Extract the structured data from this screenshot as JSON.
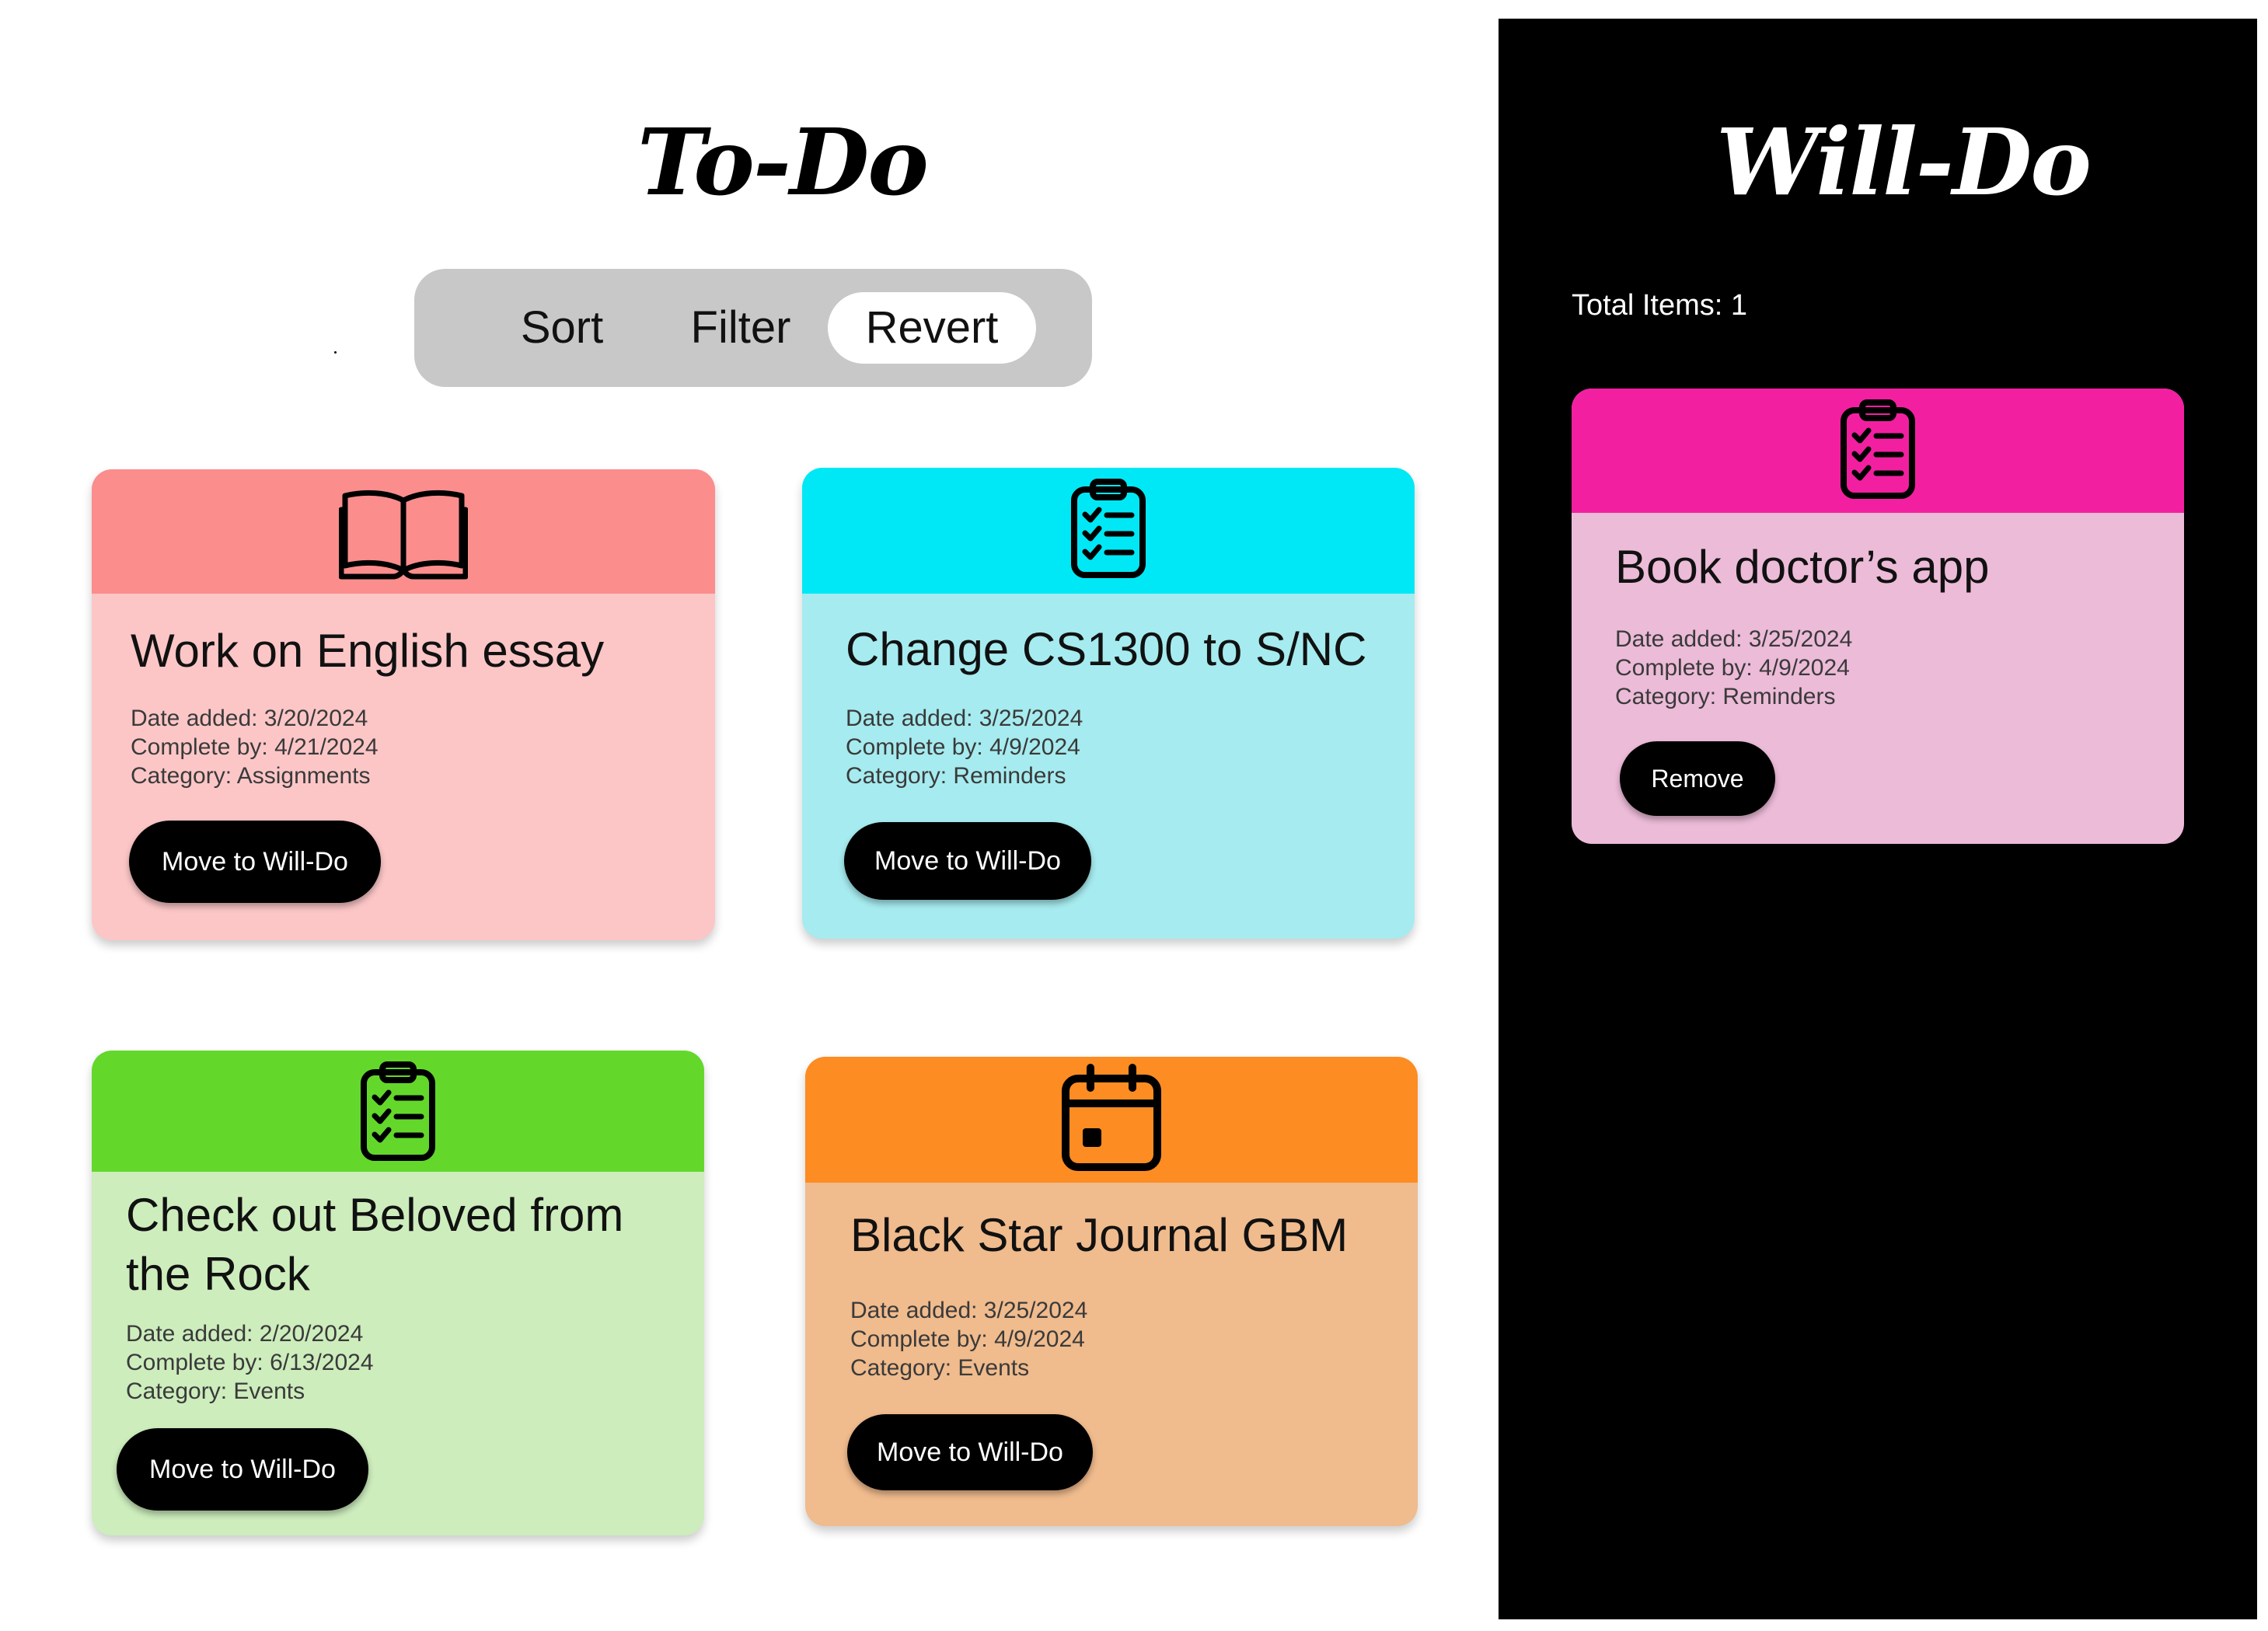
{
  "todo": {
    "title": "To-Do",
    "toolbar": {
      "sort_label": "Sort",
      "filter_label": "Filter",
      "revert_label": "Revert"
    },
    "cards": [
      {
        "title": "Work on English essay",
        "icon": "book-icon",
        "header_color": "#fb8d8d",
        "body_color": "#fcc6c7",
        "date_added": "Date added: 3/20/2024",
        "complete_by": "Complete by: 4/21/2024",
        "category": "Category: Assignments",
        "action_label": "Move to Will-Do"
      },
      {
        "title": "Change CS1300 to S/NC",
        "icon": "clipboard-checklist-icon",
        "header_color": "#00e8f5",
        "body_color": "#a6ebef",
        "date_added": "Date added: 3/25/2024",
        "complete_by": "Complete by: 4/9/2024",
        "category": "Category: Reminders",
        "action_label": "Move to Will-Do"
      },
      {
        "title_line1": "Check out Beloved from",
        "title_line2": "the Rock",
        "icon": "clipboard-checklist-icon",
        "header_color": "#63d82b",
        "body_color": "#cdedbd",
        "date_added": "Date added: 2/20/2024",
        "complete_by": "Complete by: 6/13/2024",
        "category": "Category: Events",
        "action_label": "Move to Will-Do"
      },
      {
        "title": "Black Star Journal GBM",
        "icon": "calendar-icon",
        "header_color": "#fd8c22",
        "body_color": "#f0bb8d",
        "date_added": "Date added: 3/25/2024",
        "complete_by": "Complete by: 4/9/2024",
        "category": "Category: Events",
        "action_label": "Move to Will-Do"
      }
    ]
  },
  "willdo": {
    "title": "Will-Do",
    "total_items": "Total Items: 1",
    "panel_color": "#000000",
    "cards": [
      {
        "title": "Book doctor’s app",
        "icon": "clipboard-checklist-icon",
        "header_color": "#f220a0",
        "body_color": "#ecbbd8",
        "date_added": "Date added: 3/25/2024",
        "complete_by": "Complete by: 4/9/2024",
        "category": "Category: Reminders",
        "action_label": "Remove"
      }
    ]
  }
}
